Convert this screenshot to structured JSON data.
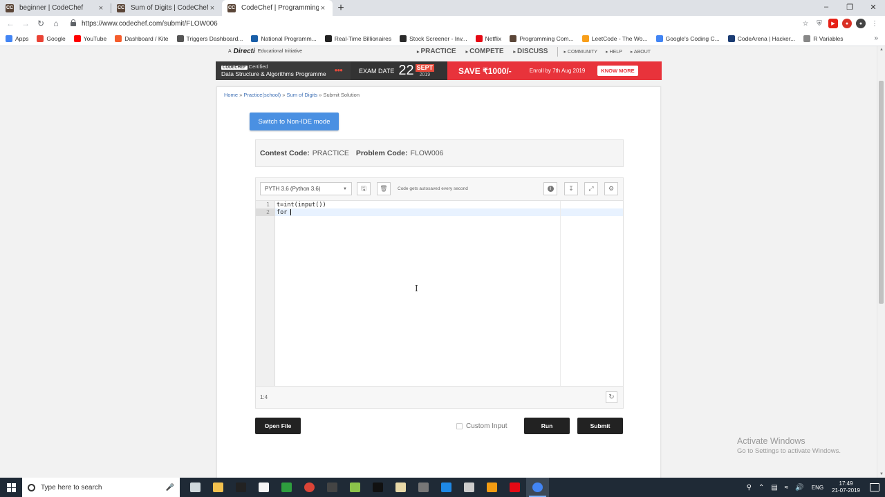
{
  "browser": {
    "tabs": [
      {
        "favicon": "CC",
        "title": "beginner | CodeChef",
        "close": "×",
        "active": false
      },
      {
        "favicon": "CC",
        "title": "Sum of Digits | CodeChef",
        "close": "×",
        "active": false
      },
      {
        "favicon": "CC",
        "title": "CodeChef | Programming Compe",
        "close": "×",
        "active": true
      }
    ],
    "new_tab": "+",
    "window_controls": [
      "–",
      "❐",
      "✕"
    ],
    "url": "https://www.codechef.com/submit/FLOW006",
    "bookmarks": [
      {
        "label": "Apps",
        "color": "#4285f4"
      },
      {
        "label": "Google",
        "color": "#ea4335"
      },
      {
        "label": "YouTube",
        "color": "#ff0000"
      },
      {
        "label": "Dashboard / Kite",
        "color": "#f55d2c"
      },
      {
        "label": "Triggers Dashboard...",
        "color": "#555555"
      },
      {
        "label": "National Programm...",
        "color": "#1a5fa8"
      },
      {
        "label": "Real-Time Billionaires",
        "color": "#222222"
      },
      {
        "label": "Stock Screener - Inv...",
        "color": "#2b2b2b"
      },
      {
        "label": "Netflix",
        "color": "#e50914"
      },
      {
        "label": "Programming Com...",
        "color": "#5b4638"
      },
      {
        "label": "LeetCode - The Wo...",
        "color": "#f89f1b"
      },
      {
        "label": "Google's Coding C...",
        "color": "#4285f4"
      },
      {
        "label": "CodeArena | Hacker...",
        "color": "#1b3c73"
      },
      {
        "label": "R Variables",
        "color": "#888888"
      }
    ],
    "bookmarks_more": "»"
  },
  "site": {
    "directi_prefix": "A",
    "directi_brand": "Directi",
    "directi_suffix": "Educational Initiative",
    "nav_main": [
      "PRACTICE",
      "COMPETE",
      "DISCUSS"
    ],
    "nav_sub": [
      "COMMUNITY",
      "HELP",
      "ABOUT"
    ]
  },
  "banner": {
    "cert_badge": "CODECHEF",
    "cert_text": "Certified",
    "programme": "Data Structure & Algorithms Programme",
    "exam_label": "EXAM DATE",
    "exam_day": "22",
    "exam_month": "SEPT",
    "exam_year": "2019",
    "save": "SAVE ₹1000/-",
    "enroll": "Enroll by 7th Aug 2019",
    "cta": "KNOW MORE"
  },
  "breadcrumb": {
    "items": [
      "Home",
      "Practice(school)",
      "Sum of Digits"
    ],
    "separator": "»",
    "current": "Submit Solution"
  },
  "switch_button": "Switch to Non-IDE mode",
  "contest": {
    "contest_label": "Contest Code:",
    "contest_value": "PRACTICE",
    "problem_label": "Problem Code:",
    "problem_value": "FLOW006"
  },
  "editor": {
    "language": "PYTH 3.6 (Python 3.6)",
    "autosave_note": "Code gets autosaved every second",
    "lines": [
      {
        "num": "1",
        "code": "t=int(input())"
      },
      {
        "num": "2",
        "code": "for "
      }
    ],
    "cursor_position": "1:4"
  },
  "actions": {
    "open_file": "Open File",
    "custom_input": "Custom Input",
    "run": "Run",
    "submit": "Submit"
  },
  "watermark": {
    "line1": "Activate Windows",
    "line2": "Go to Settings to activate Windows."
  },
  "taskbar": {
    "search_placeholder": "Type here to search",
    "language": "ENG",
    "time": "17:49",
    "date": "21-07-2019",
    "app_colors": [
      "#cfd8dc",
      "#f2c14e",
      "#222222",
      "#f5f5f5",
      "#2e9e3e",
      "#db4437",
      "#444444",
      "#8bc34a",
      "#111111",
      "#e8d9a8",
      "#777777",
      "#1e88e5",
      "#cccccc",
      "#f39c12",
      "#e50914",
      "#4285f4"
    ]
  }
}
